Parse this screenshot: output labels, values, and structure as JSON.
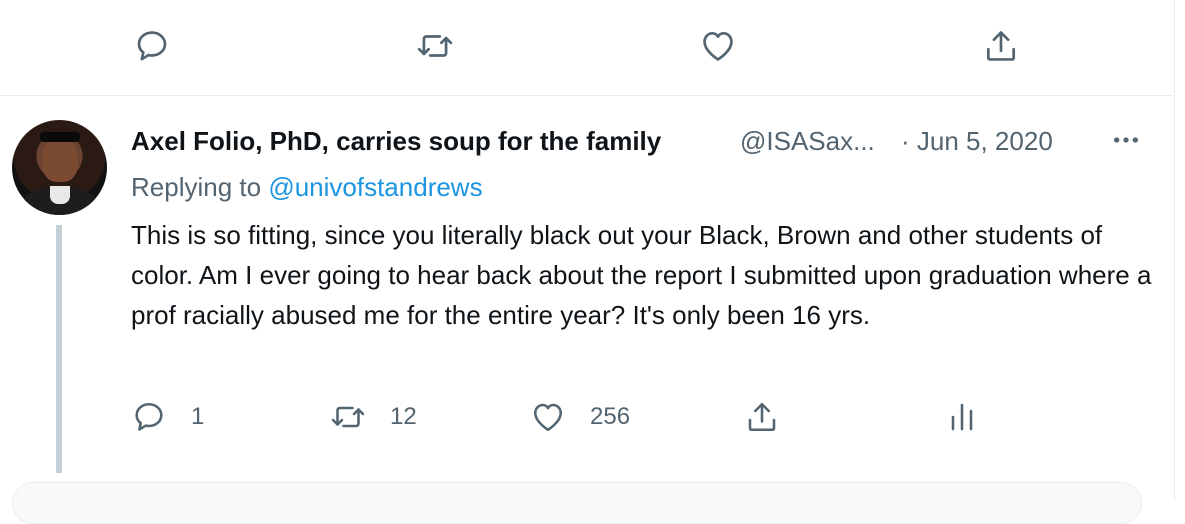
{
  "top_actions": {
    "icons": [
      "reply-icon",
      "retweet-icon",
      "like-icon",
      "share-icon"
    ]
  },
  "tweet": {
    "author_name": "Axel Folio, PhD, carries soup for the family",
    "handle": "@ISASax...",
    "date": "· Jun 5, 2020",
    "replying_prefix": "Replying to ",
    "replying_to": "@univofstandrews",
    "text": "This is so fitting, since you literally black out your Black, Brown and other students of color. Am I ever going to hear back about the report I submitted upon graduation where a prof racially abused me for the entire year? It's only been 16 yrs.",
    "counts": {
      "replies": "1",
      "retweets": "12",
      "likes": "256"
    }
  },
  "colors": {
    "text": "#0f1419",
    "muted": "#536471",
    "link": "#1b95e0",
    "thread_line": "#c4cfd6",
    "border": "#e6ecf0"
  }
}
